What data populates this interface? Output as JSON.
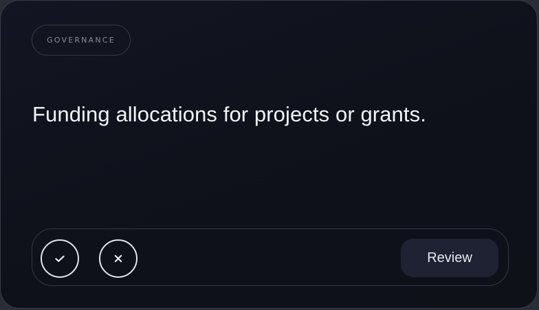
{
  "card": {
    "tag": "GOVERNANCE",
    "headline": "Funding allocations for projects or grants."
  },
  "actions": {
    "approve_icon": "check-icon",
    "reject_icon": "close-icon",
    "review_label": "Review"
  },
  "colors": {
    "background": "#0f111b",
    "border": "#3a3d4a",
    "text": "#f3f4f8",
    "tag_text": "#8a8d9a",
    "review_button": "#1e2233"
  }
}
